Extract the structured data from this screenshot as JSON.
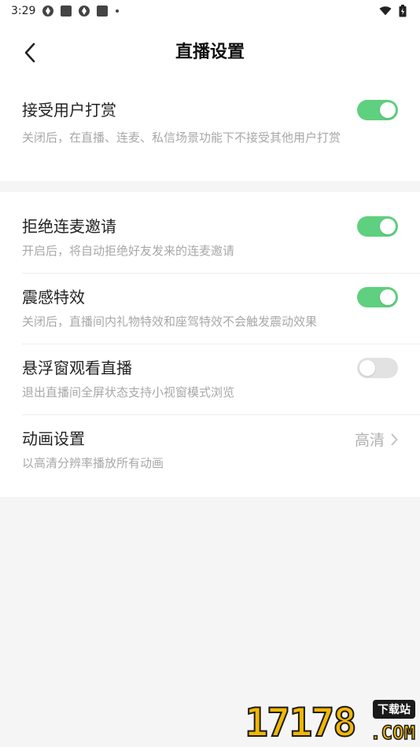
{
  "status_bar": {
    "time": "3:29",
    "icons": [
      "gear-notification-icon",
      "square-notification-icon",
      "gear-notification-icon",
      "square-notification-icon",
      "dot-icon"
    ],
    "right_icons": [
      "wifi-icon",
      "battery-icon"
    ]
  },
  "header": {
    "title": "直播设置",
    "back_icon": "chevron-left-icon"
  },
  "settings": {
    "reward": {
      "label": "接受用户打赏",
      "desc": "关闭后，在直播、连麦、私信场景功能下不接受其他用户打赏",
      "enabled": true
    },
    "reject_link": {
      "label": "拒绝连麦邀请",
      "desc": "开启后，将自动拒绝好友发来的连麦邀请",
      "enabled": true
    },
    "vibration": {
      "label": "震感特效",
      "desc": "关闭后，直播间内礼物特效和座驾特效不会触发震动效果",
      "enabled": true
    },
    "floating_window": {
      "label": "悬浮窗观看直播",
      "desc": "退出直播间全屏状态支持小视窗模式浏览",
      "enabled": false
    },
    "animation": {
      "label": "动画设置",
      "desc": "以高清分辨率播放所有动画",
      "value": "高清"
    }
  },
  "colors": {
    "toggle_on": "#5fd07f",
    "toggle_off": "#e2e2e2",
    "desc_text": "#a8a8a8",
    "page_bg": "#f5f5f5"
  },
  "watermark": {
    "number": "17178",
    "badge": "下载站",
    "domain": ".COM"
  }
}
